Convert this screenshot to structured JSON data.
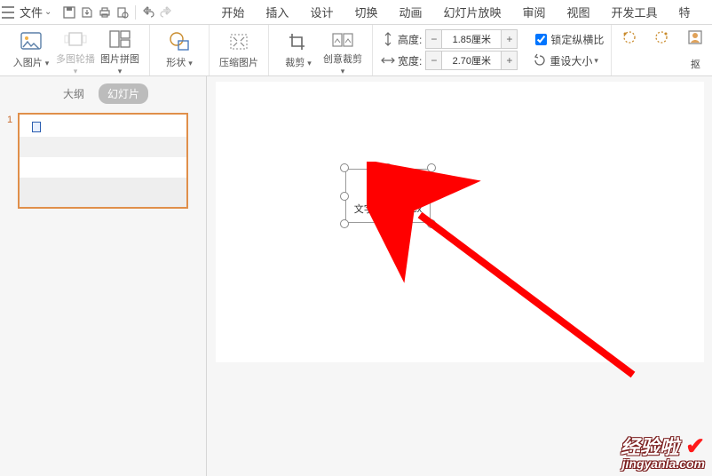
{
  "menu": {
    "file_label": "文件",
    "tabs": [
      "开始",
      "插入",
      "设计",
      "切换",
      "动画",
      "幻灯片放映",
      "审阅",
      "视图",
      "开发工具",
      "特"
    ]
  },
  "ribbon": {
    "insert_image": "入图片",
    "multi_image": "多图轮播",
    "image_collage": "图片拼图",
    "shape": "形状",
    "compress": "压缩图片",
    "crop": "裁剪",
    "creative_crop": "创意裁剪",
    "height_label": "高度:",
    "width_label": "宽度:",
    "height_value": "1.85厘米",
    "width_value": "2.70厘米",
    "lock_aspect": "锁定纵横比",
    "lock_checked": true,
    "reset_size": "重设大小",
    "matting": "抠"
  },
  "side": {
    "outline_tab": "大纲",
    "slides_tab": "幻灯片",
    "slide_number": "1"
  },
  "slide": {
    "embedded_filename": "文字文稿1.docx"
  },
  "watermark": {
    "title": "经验啦",
    "url": "jingyanla.com"
  }
}
